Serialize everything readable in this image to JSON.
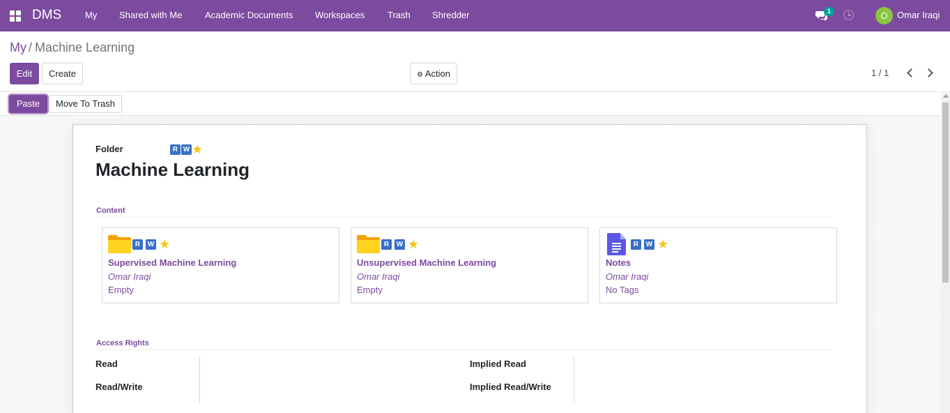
{
  "navbar": {
    "brand": "DMS",
    "menu": [
      "My",
      "Shared with Me",
      "Academic Documents",
      "Workspaces",
      "Trash",
      "Shredder"
    ],
    "messages_count": "1",
    "user_initial": "O",
    "user_name": "Omar Iraqi"
  },
  "breadcrumb": {
    "parent": "My",
    "separator": "/",
    "current": "Machine Learning"
  },
  "control_panel": {
    "edit_label": "Edit",
    "create_label": "Create",
    "action_label": "Action",
    "pager": "1 / 1"
  },
  "statusbar": {
    "paste_label": "Paste",
    "trash_label": "Move To Trash"
  },
  "form": {
    "type_label": "Folder",
    "permissions": [
      "R",
      "W"
    ],
    "title": "Machine Learning",
    "content_section": "Content",
    "cards": [
      {
        "name": "Supervised Machine Learning",
        "owner": "Omar Iraqi",
        "meta": "Empty",
        "kind": "folder",
        "permissions": [
          "R",
          "W"
        ]
      },
      {
        "name": "Unsupervised Machine Learning",
        "owner": "Omar Iraqi",
        "meta": "Empty",
        "kind": "folder",
        "permissions": [
          "R",
          "W"
        ]
      },
      {
        "name": "Notes",
        "owner": "Omar Iraqi",
        "meta": "No Tags",
        "kind": "document",
        "permissions": [
          "R",
          "W"
        ]
      }
    ],
    "access_section": "Access Rights",
    "access_fields": {
      "read": "Read",
      "read_write": "Read/Write",
      "implied_read": "Implied Read",
      "implied_read_write": "Implied Read/Write"
    }
  },
  "colors": {
    "brand": "#7c4a9e",
    "badge": "#00a09d",
    "avatar": "#8cc63f",
    "permission_badge": "#3a6ec7",
    "star": "#f5c518"
  }
}
